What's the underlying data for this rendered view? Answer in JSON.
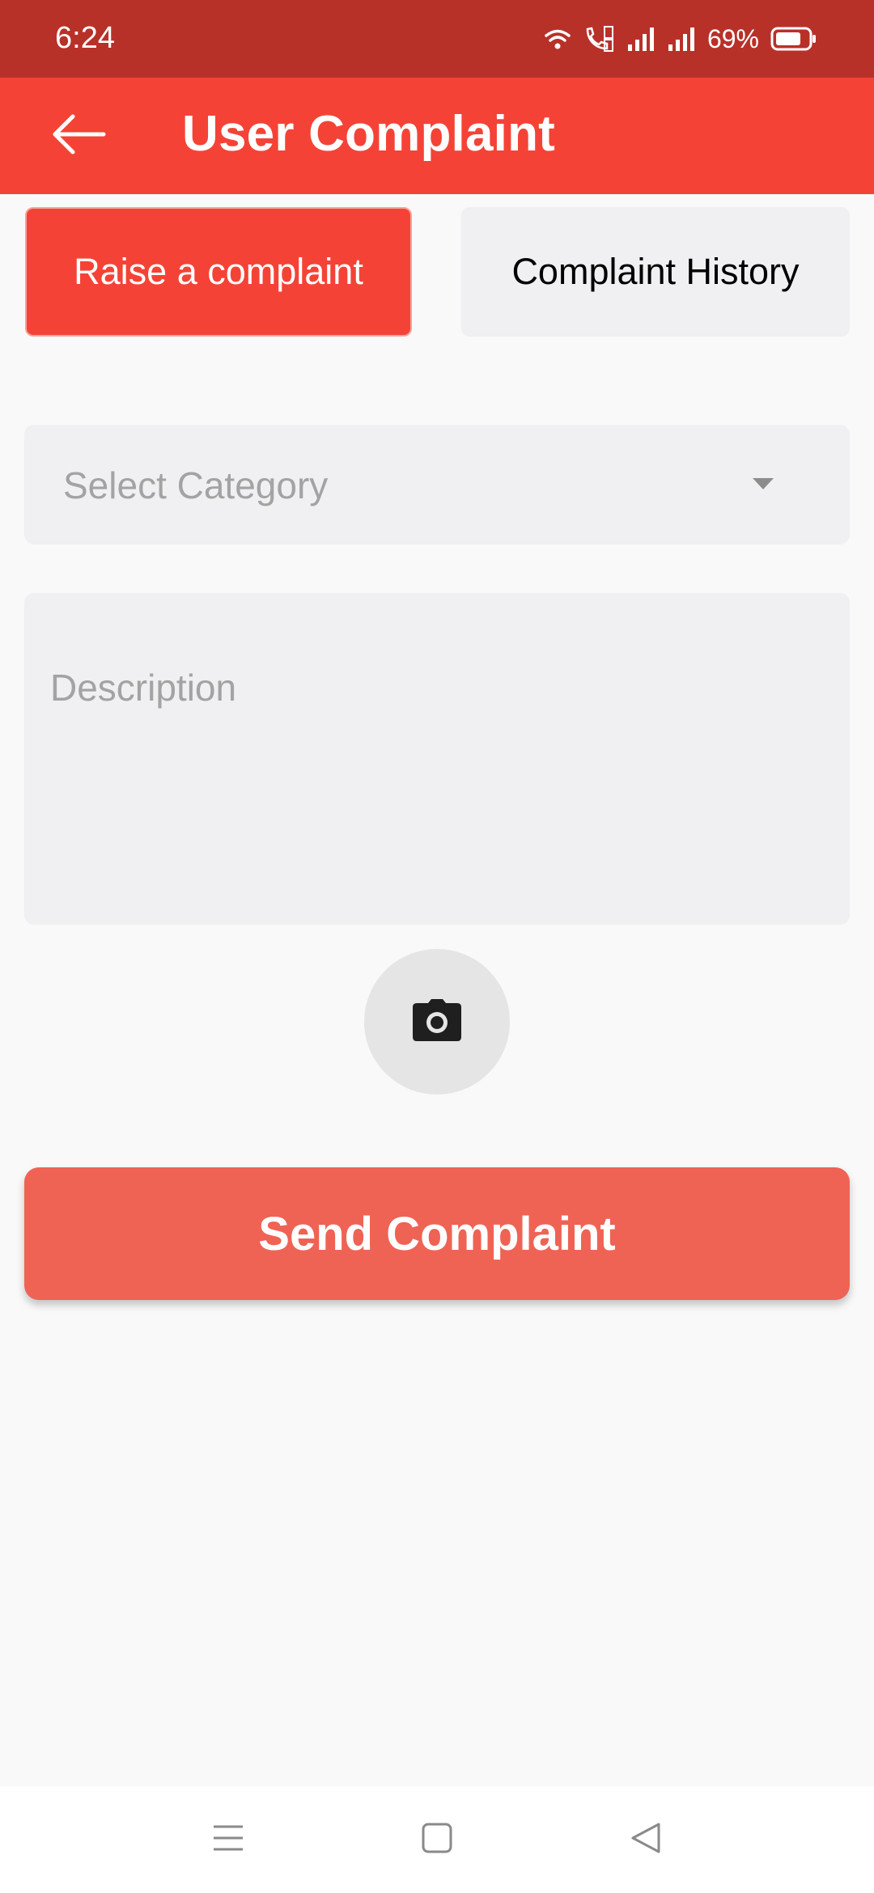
{
  "status_bar": {
    "time": "6:24",
    "battery_percent": "69%",
    "icons": [
      "wifi-icon",
      "volte-call-icon",
      "signal-1-icon",
      "signal-2-icon",
      "battery-icon"
    ]
  },
  "app_bar": {
    "title": "User Complaint",
    "back_icon": "arrow-left-icon"
  },
  "tabs": [
    {
      "label": "Raise a complaint",
      "active": true
    },
    {
      "label": "Complaint History",
      "active": false
    }
  ],
  "form": {
    "category_placeholder": "Select Category",
    "description_placeholder": "Description",
    "camera_icon": "camera-icon",
    "submit_label": "Send Complaint"
  },
  "nav_bar": {
    "items": [
      "menu-icon",
      "home-icon",
      "back-triangle-icon"
    ]
  },
  "colors": {
    "status_bar": "#b83129",
    "app_bar": "#f44336",
    "active_tab": "#f44336",
    "inactive_tab": "#f0f0f2",
    "submit_button": "#ef6355",
    "background": "#f9f9f9",
    "placeholder_text": "#a3a3a3"
  }
}
